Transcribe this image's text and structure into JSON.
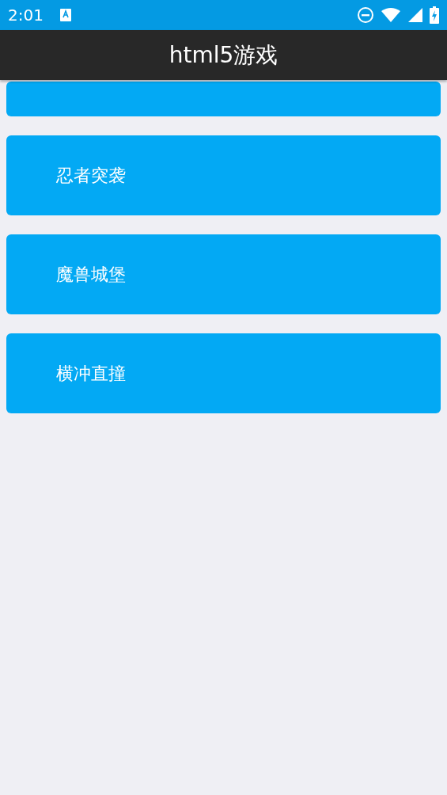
{
  "status_bar": {
    "time": "2:01"
  },
  "app_bar": {
    "title": "html5游戏"
  },
  "games": [
    {
      "kind": "clipped"
    },
    {
      "kind": "full",
      "label": "忍者突袭"
    },
    {
      "kind": "full",
      "label": "魔兽城堡"
    },
    {
      "kind": "full",
      "label": "横冲直撞"
    }
  ]
}
